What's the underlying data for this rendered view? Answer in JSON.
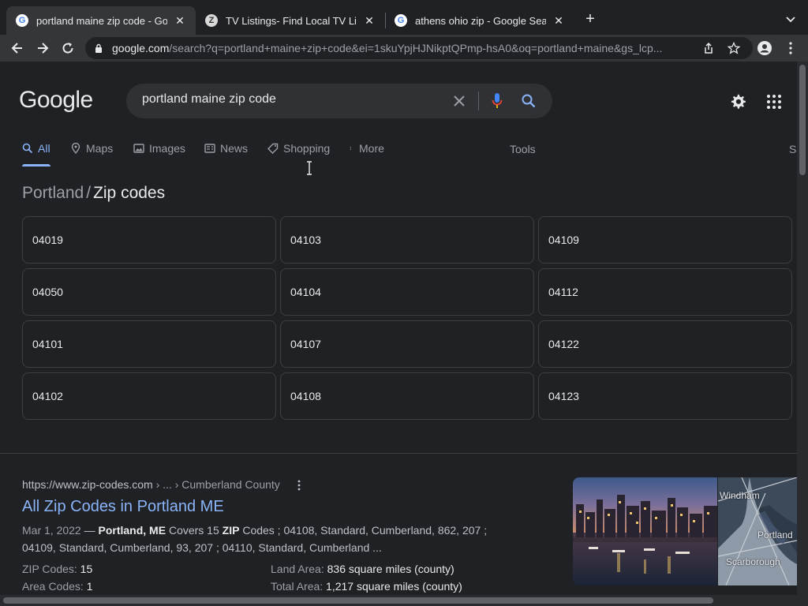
{
  "tabs": [
    {
      "title": "portland maine zip code - Goog",
      "favicon": "google-icon",
      "active": true
    },
    {
      "title": "TV Listings- Find Local TV List",
      "favicon": "z-icon",
      "active": false
    },
    {
      "title": "athens ohio zip - Google Searc",
      "favicon": "google-icon",
      "active": false
    }
  ],
  "toolbar": {
    "url_host": "google.com",
    "url_path": "/search?q=portland+maine+zip+code&ei=1skuYpjHJNikptQPmp-hsA0&oq=portland+maine&gs_lcp..."
  },
  "logo": {
    "text": "Google"
  },
  "search": {
    "query": "portland maine zip code"
  },
  "navtabs": [
    {
      "label": "All",
      "icon": "search-icon"
    },
    {
      "label": "Maps",
      "icon": "map-pin-icon"
    },
    {
      "label": "Images",
      "icon": "image-icon"
    },
    {
      "label": "News",
      "icon": "news-icon"
    },
    {
      "label": "Shopping",
      "icon": "tag-icon"
    },
    {
      "label": "More",
      "icon": "dots-vertical-icon"
    }
  ],
  "tools_label": "Tools",
  "tools_cut": "S",
  "breadcrumb": {
    "parent": "Portland",
    "sep": "/",
    "current": "Zip codes"
  },
  "zip_codes": [
    "04019",
    "04050",
    "04101",
    "04102",
    "04103",
    "04104",
    "04107",
    "04108",
    "04109",
    "04112",
    "04122",
    "04123"
  ],
  "result": {
    "cite_host": "https://www.zip-codes.com",
    "cite_path": " › ... › Cumberland County",
    "title": "All Zip Codes in Portland ME",
    "date": "Mar 1, 2022",
    "snippet_dash": " — ",
    "snippet_b1": "Portland, ME",
    "snippet_t1": " Covers 15 ",
    "snippet_b2": "ZIP",
    "snippet_t2": " Codes ; 04108, Standard, Cumberland, 862, 207 ; 04109, Standard, Cumberland, 93, 207 ; 04110, Standard, Cumberland ...",
    "facts": [
      {
        "label": "ZIP Codes: ",
        "value": "15"
      },
      {
        "label": "Area Codes: ",
        "value": "1"
      },
      {
        "label": "Land Area: ",
        "value": "836 square miles (county)"
      },
      {
        "label": "Total Area: ",
        "value": "1,217 square miles (county)"
      }
    ]
  },
  "map_labels": [
    "Windham",
    "Portland",
    "Scarborough"
  ],
  "colors": {
    "link": "#8ab4f8",
    "background": "#202124"
  }
}
